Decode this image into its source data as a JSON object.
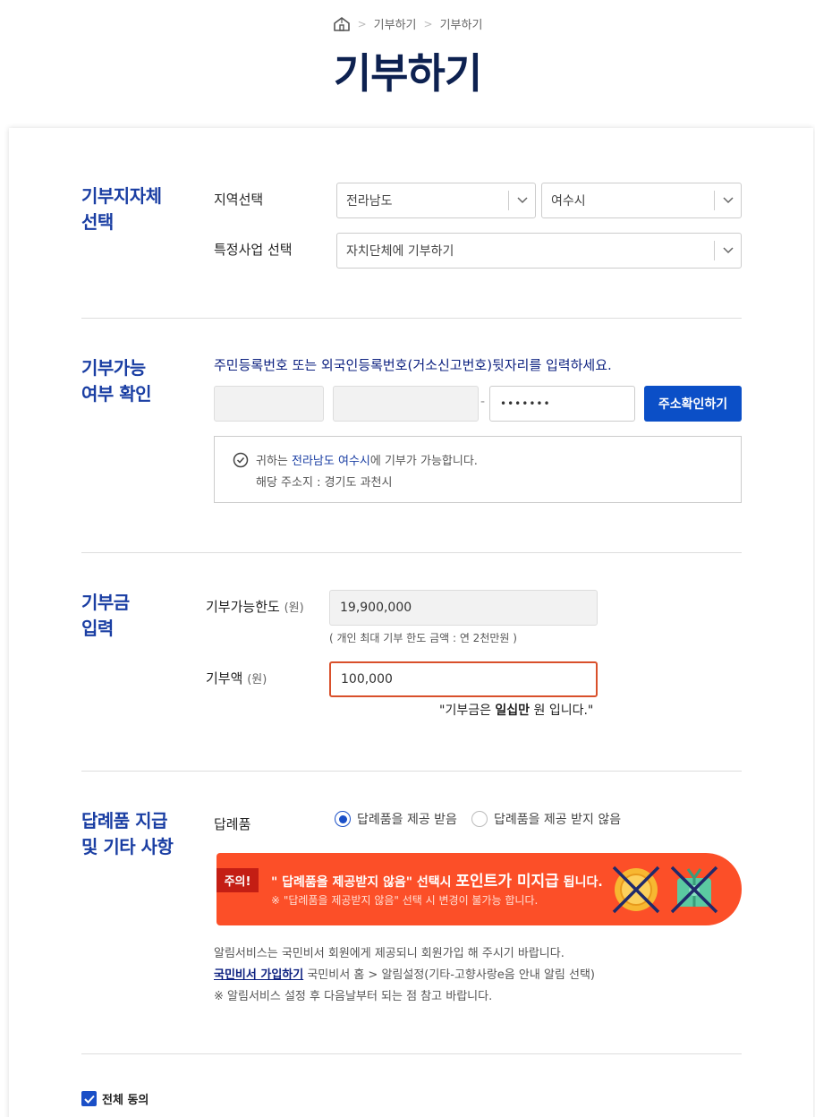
{
  "breadcrumb": {
    "items": [
      "기부하기",
      "기부하기"
    ]
  },
  "page_title": "기부하기",
  "section_region": {
    "title_line1": "기부지자체",
    "title_line2": "선택",
    "region_label": "지역선택",
    "province_value": "전라남도",
    "city_value": "여수시",
    "project_label": "특정사업 선택",
    "project_value": "자치단체에 기부하기"
  },
  "section_eligibility": {
    "title_line1": "기부가능",
    "title_line2": "여부 확인",
    "instruction": "주민등록번호 또는 외국인등록번호(거소신고번호)뒷자리를 입력하세요.",
    "field1_value": "",
    "field2_value": "",
    "dash": "-",
    "password_value": "•••••••",
    "button_label": "주소확인하기",
    "result_prefix": "귀하는 ",
    "result_highlight": "전라남도 여수시",
    "result_suffix": "에 기부가 가능합니다.",
    "address_line": "해당 주소지 : 경기도 과천시"
  },
  "section_amount": {
    "title_line1": "기부금",
    "title_line2": "입력",
    "limit_label": "기부가능한도",
    "unit": "(원)",
    "limit_value": "19,900,000",
    "limit_note": "( 개인 최대 기부 한도 금액 : 연 2천만원 )",
    "amount_label": "기부액",
    "amount_value": "100,000",
    "amount_words_prefix": "\"기부금은 ",
    "amount_words_bold": "일십만",
    "amount_words_suffix": " 원 입니다.\""
  },
  "section_gift": {
    "title_line1": "답례품 지급",
    "title_line2": "및 기타 사항",
    "gift_label": "답례품",
    "option_receive": "답례품을 제공 받음",
    "option_decline": "답례품을 제공 받지 않음",
    "selected": "receive",
    "banner": {
      "tag": "주의!",
      "line1_prefix": "\" 답례품을 제공받지 않음\" 선택시 ",
      "line1_big": "포인트가 미지급",
      "line1_suffix": " 됩니다.",
      "line2": "※ \"답례품을 제공받지 않음\" 선택 시 변경이 불가능 합니다."
    },
    "info_line1": "알림서비스는 국민비서 회원에게 제공되니 회원가입 해 주시기 바랍니다.",
    "info_link": "국민비서 가입하기",
    "info_line2_suffix": " 국민비서 홈 > 알림설정(기타-고향사랑e음 안내 알림 선택)",
    "info_line3": "※ 알림서비스 설정 후 다음날부터 되는 점 참고 바랍니다."
  },
  "agree_all": {
    "label": "전체 동의",
    "checked": true
  },
  "colors": {
    "title_navy": "#0d2150",
    "section_blue": "#1a3ea3",
    "button_blue": "#0b4fc7",
    "banner_orange": "#fc4f28",
    "focus_border": "#d9502b"
  }
}
